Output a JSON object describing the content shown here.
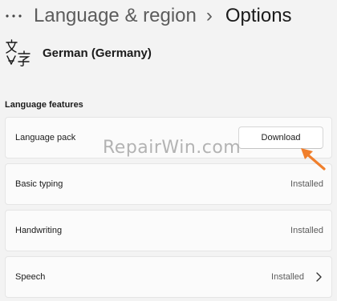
{
  "breadcrumb": {
    "more_label": "···",
    "parent": "Language & region",
    "separator": "›",
    "current": "Options"
  },
  "language": {
    "name": "German (Germany)",
    "icon": "language-icon"
  },
  "section": {
    "title": "Language features"
  },
  "features": [
    {
      "label": "Language pack",
      "action": "Download"
    },
    {
      "label": "Basic typing",
      "status": "Installed"
    },
    {
      "label": "Handwriting",
      "status": "Installed"
    },
    {
      "label": "Speech",
      "status": "Installed",
      "icon": "chevron-right-icon"
    }
  ],
  "watermark": "RepairWin.com",
  "colors": {
    "background": "#f3f3f3",
    "card": "#fbfbfb",
    "arrow": "#f07f2c"
  }
}
